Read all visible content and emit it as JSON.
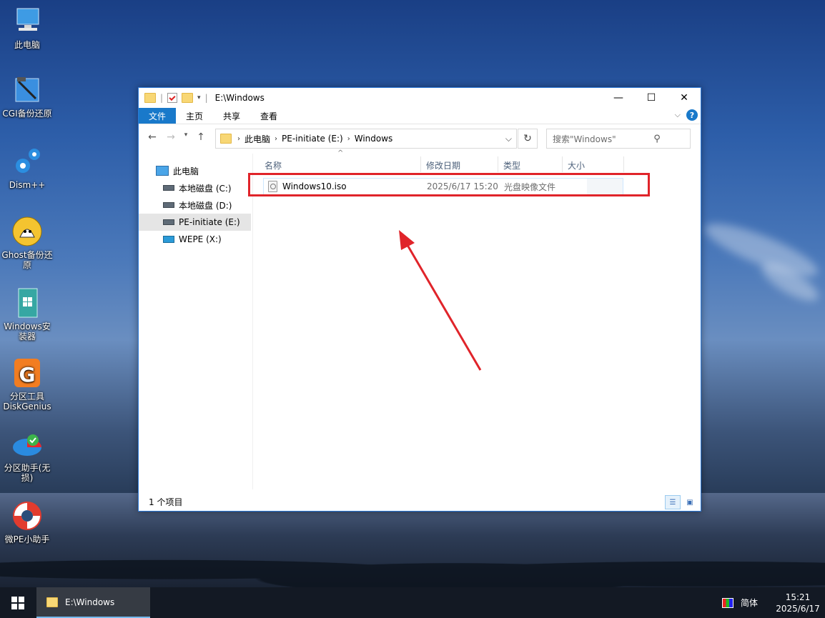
{
  "desktop": {
    "icons": [
      {
        "label": "此电脑",
        "icon": "computer-icon"
      },
      {
        "label": "CGI备份还原",
        "icon": "cgi-backup-icon"
      },
      {
        "label": "Dism++",
        "icon": "dism-gears-icon"
      },
      {
        "label": "Ghost备份还\n原",
        "icon": "ghost-icon"
      },
      {
        "label": "Windows安\n装器",
        "icon": "windows-installer-icon"
      },
      {
        "label": "分区工具\nDiskGenius",
        "icon": "diskgenius-icon"
      },
      {
        "label": "分区助手(无\n损)",
        "icon": "partition-assistant-icon"
      },
      {
        "label": "微PE小助手",
        "icon": "lifebuoy-icon"
      }
    ]
  },
  "window": {
    "title": "E:\\Windows",
    "controls": {
      "minimize": "—",
      "maximize": "☐",
      "close": "✕"
    },
    "ribbon_tabs": [
      "文件",
      "主页",
      "共享",
      "查看"
    ],
    "address": {
      "segments": [
        "此电脑",
        "PE-initiate (E:)",
        "Windows"
      ]
    },
    "search_placeholder": "搜索\"Windows\"",
    "nav_tree": [
      {
        "label": "此电脑",
        "type": "pc"
      },
      {
        "label": "本地磁盘 (C:)",
        "type": "drive"
      },
      {
        "label": "本地磁盘 (D:)",
        "type": "drive"
      },
      {
        "label": "PE-initiate (E:)",
        "type": "drive",
        "selected": true
      },
      {
        "label": "WEPE (X:)",
        "type": "netdrive"
      }
    ],
    "columns": [
      "名称",
      "修改日期",
      "类型",
      "大小"
    ],
    "files": [
      {
        "name": "Windows10.iso",
        "modified": "2025/6/17 15:20",
        "type": "光盘映像文件",
        "size": ""
      }
    ],
    "status": "1 个项目"
  },
  "annotation": {
    "color": "#e0242a"
  },
  "taskbar": {
    "active_window": "E:\\Windows",
    "ime": "简体",
    "time": "15:21",
    "date": "2025/6/17"
  }
}
